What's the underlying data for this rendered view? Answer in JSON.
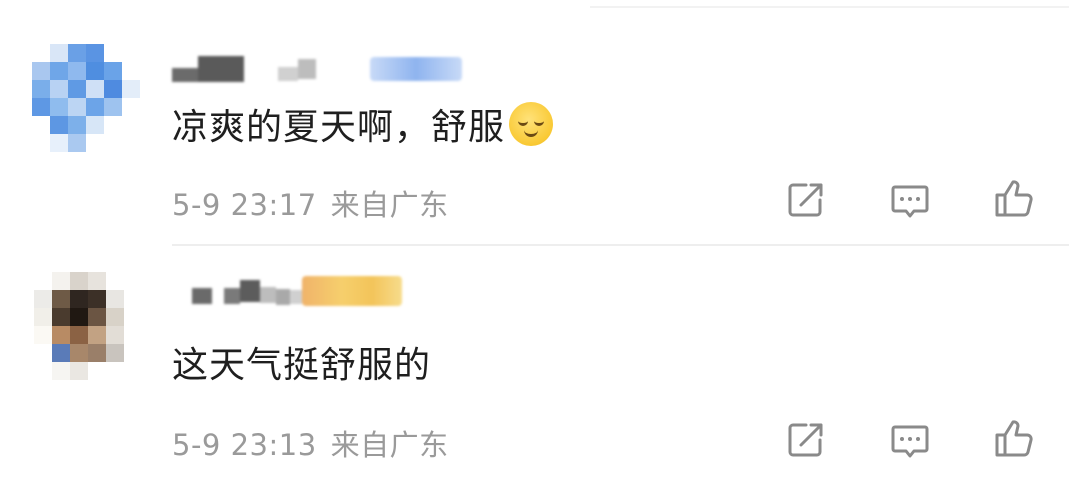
{
  "comments": [
    {
      "text": "凉爽的夏天啊，舒服",
      "emoji": "relieved-face-emoji",
      "time": "5-9 23:17",
      "location": "来自广东",
      "actions": [
        "share-icon",
        "comment-icon",
        "like-icon"
      ]
    },
    {
      "text": "这天气挺舒服的",
      "time": "5-9 23:13",
      "location": "来自广东",
      "actions": [
        "share-icon",
        "comment-icon",
        "like-icon"
      ]
    }
  ],
  "colors": {
    "text": "#1f1f1f",
    "meta": "#9a9a9a",
    "icon": "#8a8a8a"
  }
}
